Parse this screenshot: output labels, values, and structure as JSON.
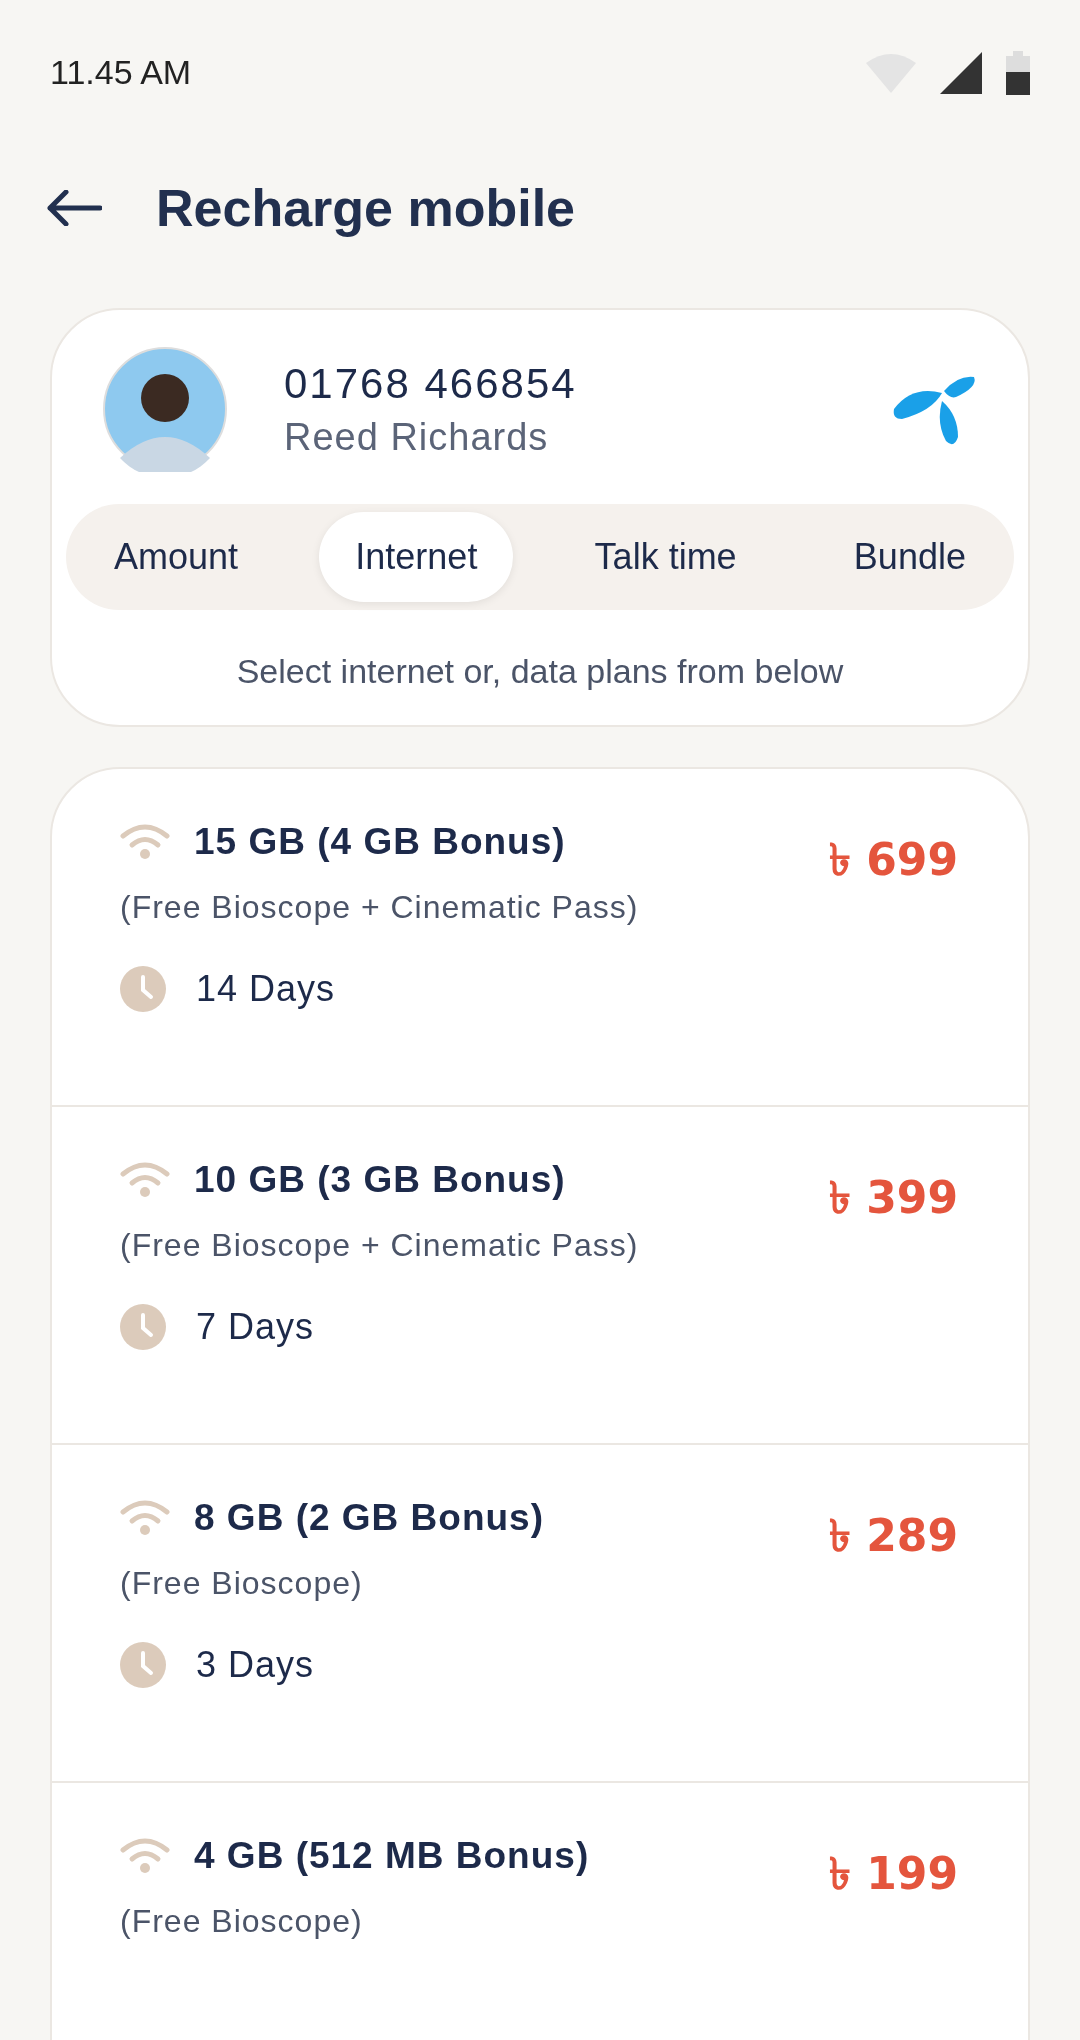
{
  "status_bar": {
    "time": "11.45 AM"
  },
  "header": {
    "title": "Recharge mobile"
  },
  "contact": {
    "number": "01768 466854",
    "name": "Reed Richards"
  },
  "tabs": [
    {
      "label": "Amount",
      "selected": false
    },
    {
      "label": "Internet",
      "selected": true
    },
    {
      "label": "Talk time",
      "selected": false
    },
    {
      "label": "Bundle",
      "selected": false
    }
  ],
  "hint": "Select internet or, data plans from below",
  "plans": [
    {
      "title": "15 GB (4 GB Bonus)",
      "note": "(Free Bioscope + Cinematic Pass)",
      "validity": "14 Days",
      "price": "৳ 699"
    },
    {
      "title": "10 GB (3 GB Bonus)",
      "note": "(Free Bioscope + Cinematic Pass)",
      "validity": "7 Days",
      "price": "৳ 399"
    },
    {
      "title": "8 GB (2 GB Bonus)",
      "note": "(Free Bioscope)",
      "validity": "3 Days",
      "price": "৳ 289"
    },
    {
      "title": "4 GB (512 MB Bonus)",
      "note": "(Free Bioscope)",
      "price": "৳ 199"
    }
  ]
}
